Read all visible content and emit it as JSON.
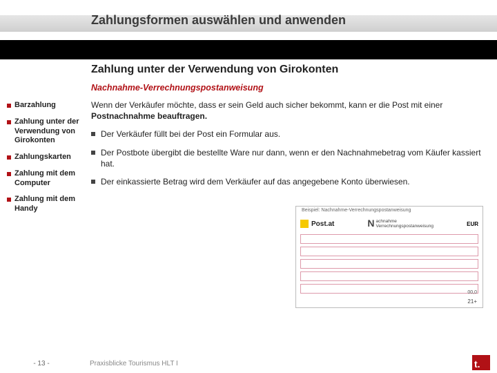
{
  "header": {
    "title": "Zahlungsformen auswählen und anwenden"
  },
  "main": {
    "heading": "Zahlung unter der Verwendung von Girokonten",
    "subheading": "Nachnahme-Verrechnungspostanweisung",
    "intro_1": "Wenn der Verkäufer möchte, dass er sein Geld auch sicher bekommt, kann er die Post mit einer ",
    "intro_strong": "Postnachnahme beauftragen.",
    "bullets": [
      "Der Verkäufer füllt bei der Post ein Formular aus.",
      "Der Postbote übergibt die bestellte Ware nur dann, wenn er den Nachnahmebetrag vom Käufer kassiert hat.",
      "Der einkassierte Betrag wird dem Verkäufer auf das angegebene Konto überwiesen."
    ]
  },
  "sidebar": {
    "items": [
      "Barzahlung",
      "Zahlung unter der Ver­wendung von Girokonten",
      "Zahlungs­karten",
      "Zahlung mit dem Computer",
      "Zahlung mit dem Handy"
    ]
  },
  "form": {
    "caption": "Beispiel: Nachnahme-Verrechnungspostanweisung",
    "brand": "Post.at",
    "big_n": "N",
    "mid_text": "achnahme\nVerrechnungspostanweisung",
    "currency": "EUR",
    "total": "00,0",
    "bottom": "21+"
  },
  "footer": {
    "page": "- 13 -",
    "course": "Praxisblicke Tourismus HLT I",
    "logo": "t."
  }
}
